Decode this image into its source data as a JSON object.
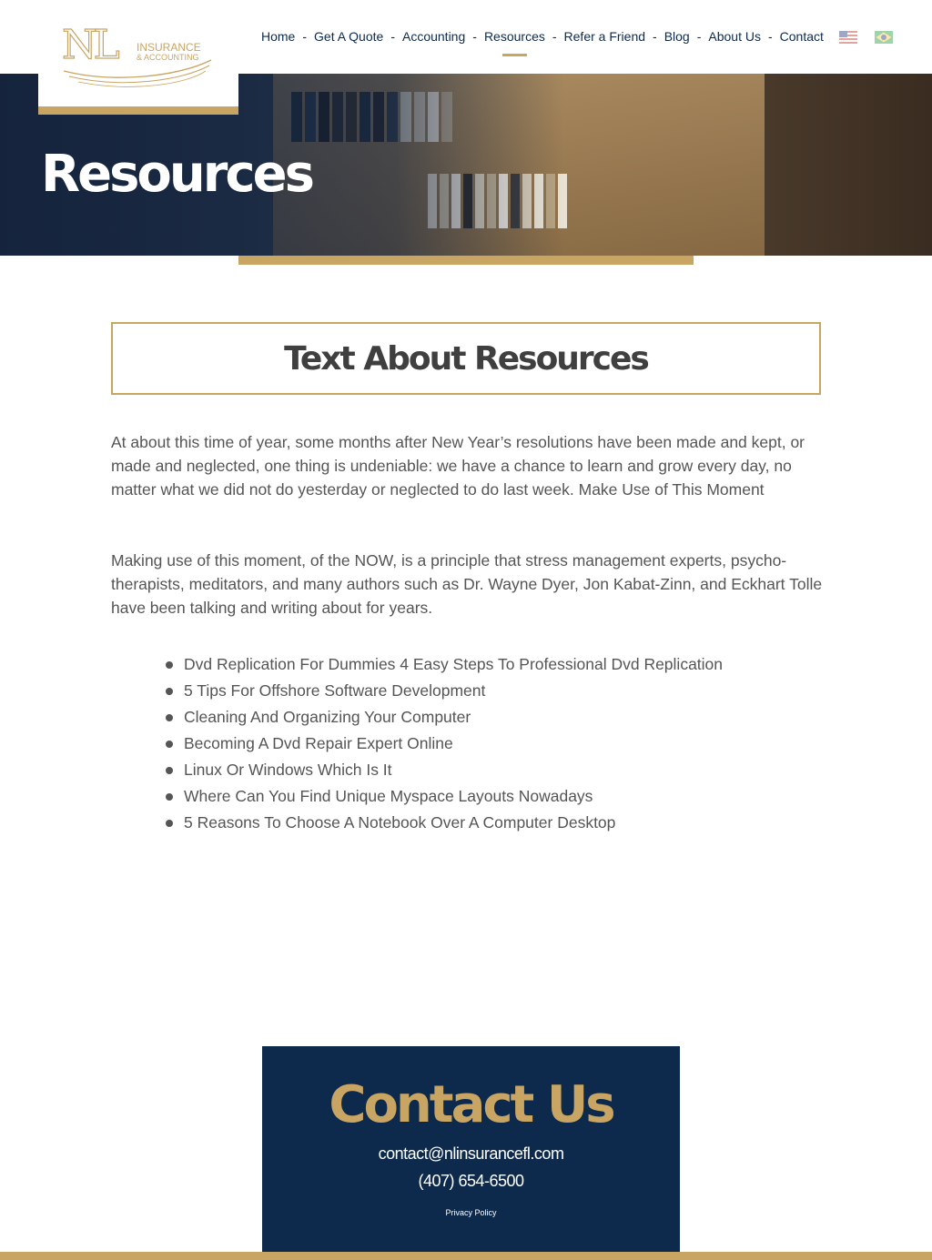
{
  "logo": {
    "brand_letters": "NL",
    "line1": "INSURANCE",
    "line2": "& ACCOUNTING"
  },
  "nav": {
    "items": [
      "Home",
      "Get A Quote",
      "Accounting",
      "Resources",
      "Refer a Friend",
      "Blog",
      "About Us",
      "Contact"
    ],
    "separator": "-",
    "active": "Resources"
  },
  "flags": [
    "us-flag-icon",
    "brazil-flag-icon"
  ],
  "hero": {
    "title": "Resources"
  },
  "content": {
    "heading": "Text About Resources",
    "paragraph1": "At about this time of year, some months after New Year’s resolutions have been made and kept, or made and neglected, one thing is undeniable: we have a chance to learn and grow every day, no matter what we did not do yesterday or neglected to do last week.  Make Use of This Moment",
    "paragraph2": "Making use of this moment, of the NOW, is a principle that stress management experts, psycho-therapists, meditators, and many authors such as Dr. Wayne Dyer, Jon Kabat-Zinn, and Eckhart Tolle have been talking and writing about for years.",
    "list": [
      "Dvd Replication For Dummies 4 Easy Steps To Professional Dvd Replication",
      "5 Tips For Offshore Software Development",
      "Cleaning And Organizing Your Computer",
      "Becoming A Dvd Repair Expert Online",
      "Linux Or Windows Which Is It",
      "Where Can You Find Unique Myspace Layouts Nowadays",
      "5 Reasons To Choose A Notebook Over A Computer Desktop"
    ]
  },
  "footer": {
    "heading": "Contact Us",
    "email": "contact@nlinsurancefl.com",
    "phone": "(407) 654-6500",
    "privacy": "Privacy Policy"
  },
  "colors": {
    "gold": "#c9a563",
    "navy": "#0d2a4d",
    "text": "#555555"
  }
}
